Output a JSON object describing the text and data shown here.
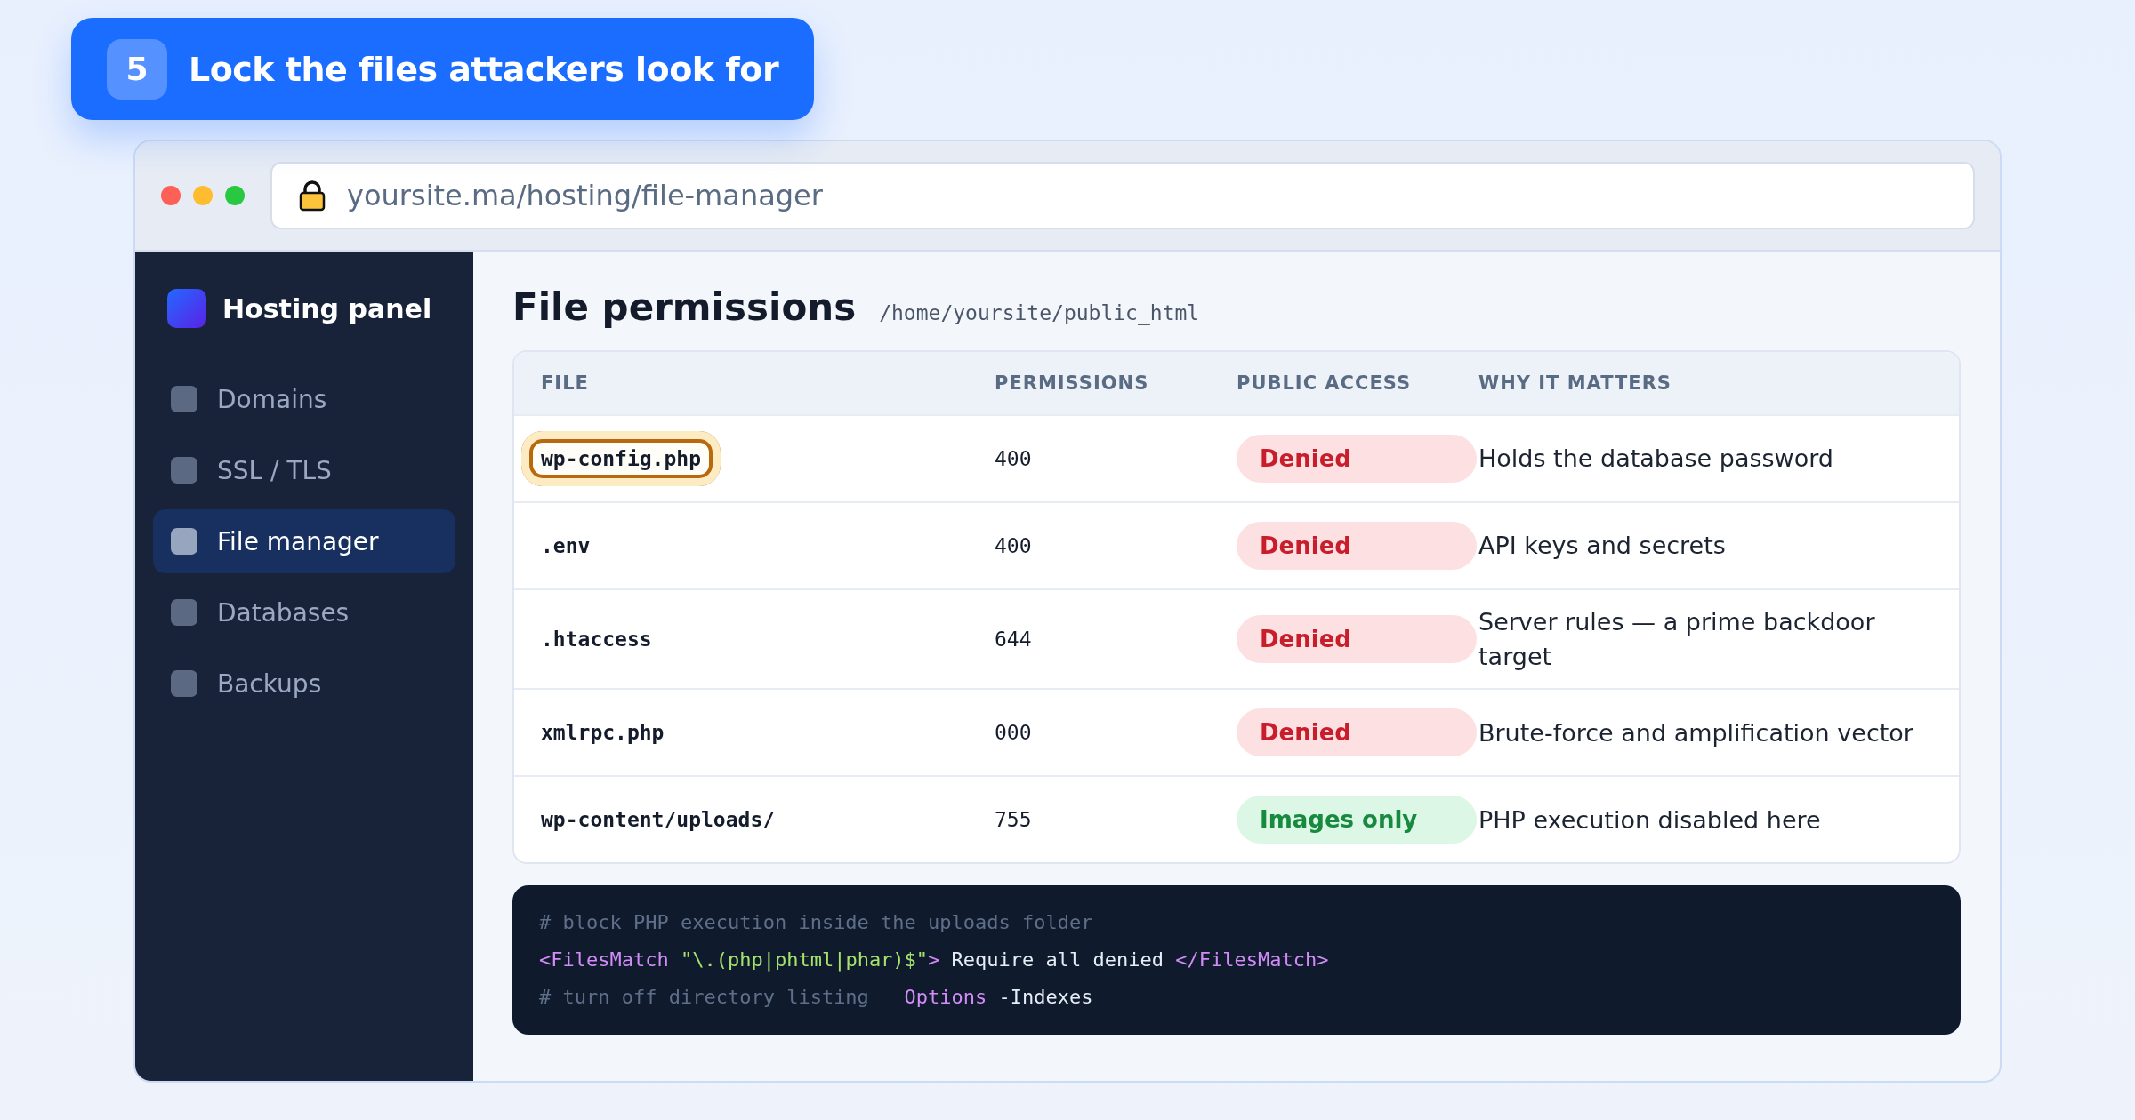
{
  "step_badge": {
    "number": "5",
    "title": "Lock the files attackers look for"
  },
  "browser": {
    "url": "yoursite.ma/hosting/file-manager"
  },
  "sidebar": {
    "brand": "Hosting panel",
    "items": [
      {
        "label": "Domains",
        "selected": false
      },
      {
        "label": "SSL / TLS",
        "selected": false
      },
      {
        "label": "File manager",
        "selected": true
      },
      {
        "label": "Databases",
        "selected": false
      },
      {
        "label": "Backups",
        "selected": false
      }
    ]
  },
  "main": {
    "title": "File permissions",
    "path": "/home/yoursite/public_html"
  },
  "table": {
    "columns": [
      "FILE",
      "PERMISSIONS",
      "PUBLIC ACCESS",
      "WHY IT MATTERS"
    ],
    "rows": [
      {
        "file": "wp-config.php",
        "highlighted": true,
        "permissions": "400",
        "access": {
          "label": "Denied",
          "kind": "denied"
        },
        "reason": "Holds the database password"
      },
      {
        "file": ".env",
        "highlighted": false,
        "permissions": "400",
        "access": {
          "label": "Denied",
          "kind": "denied"
        },
        "reason": "API keys and secrets"
      },
      {
        "file": ".htaccess",
        "highlighted": false,
        "permissions": "644",
        "access": {
          "label": "Denied",
          "kind": "denied"
        },
        "reason": "Server rules — a prime backdoor target"
      },
      {
        "file": "xmlrpc.php",
        "highlighted": false,
        "permissions": "000",
        "access": {
          "label": "Denied",
          "kind": "denied"
        },
        "reason": "Brute-force and amplification vector"
      },
      {
        "file": "wp-content/uploads/",
        "highlighted": false,
        "permissions": "755",
        "access": {
          "label": "Images only",
          "kind": "allowed"
        },
        "reason": "PHP execution disabled here"
      }
    ]
  },
  "code": {
    "lines": [
      {
        "segments": [
          {
            "kind": "comment",
            "text": "# block PHP execution inside the uploads folder"
          }
        ]
      },
      {
        "segments": [
          {
            "kind": "tag",
            "text": "<FilesMatch "
          },
          {
            "kind": "string",
            "text": "\"\\.(php|phtml|phar)$\""
          },
          {
            "kind": "tag",
            "text": ">"
          },
          {
            "kind": "plain",
            "text": " Require all denied "
          },
          {
            "kind": "tag",
            "text": "</FilesMatch>"
          }
        ]
      },
      {
        "segments": [
          {
            "kind": "comment",
            "text": "# turn off directory listing   "
          },
          {
            "kind": "tag",
            "text": "Options"
          },
          {
            "kind": "plain",
            "text": " -Indexes"
          }
        ]
      }
    ]
  }
}
